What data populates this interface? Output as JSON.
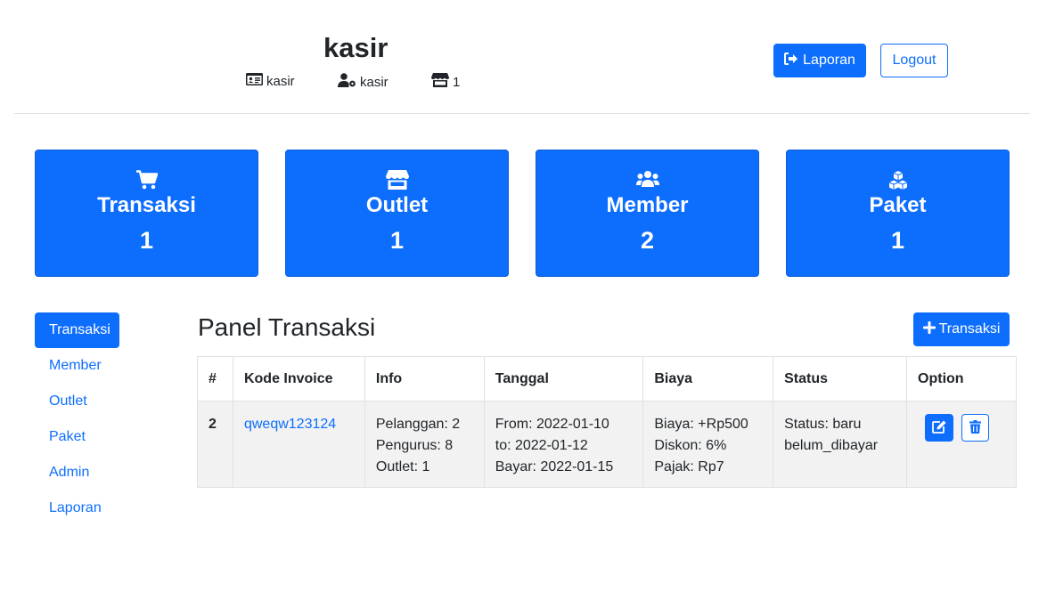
{
  "header": {
    "title": "kasir",
    "meta": [
      {
        "icon": "id-card-icon",
        "text": "kasir"
      },
      {
        "icon": "user-gear-icon",
        "text": "kasir"
      },
      {
        "icon": "store-icon",
        "text": "1"
      }
    ],
    "laporan_label": "Laporan",
    "logout_label": "Logout"
  },
  "cards": [
    {
      "icon": "cart-icon",
      "title": "Transaksi",
      "value": "1"
    },
    {
      "icon": "store-icon",
      "title": "Outlet",
      "value": "1"
    },
    {
      "icon": "users-icon",
      "title": "Member",
      "value": "2"
    },
    {
      "icon": "cubes-icon",
      "title": "Paket",
      "value": "1"
    }
  ],
  "sidebar": {
    "items": [
      {
        "label": "Transaksi",
        "active": true
      },
      {
        "label": "Member"
      },
      {
        "label": "Outlet"
      },
      {
        "label": "Paket"
      },
      {
        "label": "Admin"
      },
      {
        "label": "Laporan"
      }
    ]
  },
  "panel": {
    "title": "Panel Transaksi",
    "add_label": "Transaksi",
    "columns": [
      "#",
      "Kode Invoice",
      "Info",
      "Tanggal",
      "Biaya",
      "Status",
      "Option"
    ],
    "rows": [
      {
        "id": "2",
        "invoice": "qweqw123124",
        "info": [
          "Pelanggan: 2",
          "Pengurus: 8",
          "Outlet: 1"
        ],
        "tanggal": [
          "From: 2022-01-10",
          "to: 2022-01-12",
          "Bayar: 2022-01-15"
        ],
        "biaya": [
          "Biaya: +Rp500",
          "Diskon: 6%",
          "Pajak: Rp7"
        ],
        "status": [
          "Status: baru",
          "belum_dibayar"
        ]
      }
    ]
  },
  "colors": {
    "primary": "#0d6efd",
    "row_bg": "#f2f2f2",
    "border": "#dee2e6"
  }
}
